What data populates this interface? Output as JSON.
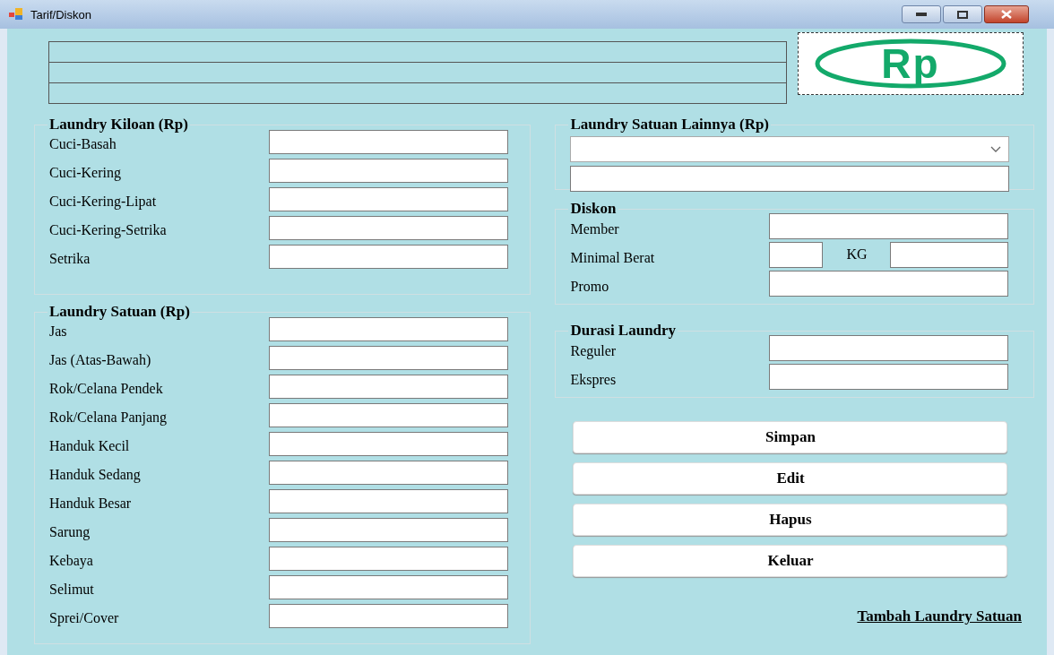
{
  "window": {
    "title": "Tarif/Diskon"
  },
  "header": {
    "logo_text": "Rp"
  },
  "laundry_kiloan": {
    "title": "Laundry Kiloan (Rp)",
    "fields": [
      {
        "label": "Cuci-Basah"
      },
      {
        "label": "Cuci-Kering"
      },
      {
        "label": "Cuci-Kering-Lipat"
      },
      {
        "label": "Cuci-Kering-Setrika"
      },
      {
        "label": "Setrika"
      }
    ]
  },
  "laundry_satuan": {
    "title": "Laundry Satuan (Rp)",
    "fields": [
      {
        "label": "Jas"
      },
      {
        "label": "Jas (Atas-Bawah)"
      },
      {
        "label": "Rok/Celana Pendek"
      },
      {
        "label": "Rok/Celana Panjang"
      },
      {
        "label": "Handuk Kecil"
      },
      {
        "label": "Handuk Sedang"
      },
      {
        "label": "Handuk Besar"
      },
      {
        "label": "Sarung"
      },
      {
        "label": "Kebaya"
      },
      {
        "label": "Selimut"
      },
      {
        "label": "Sprei/Cover"
      }
    ]
  },
  "laundry_satuan_lainnya": {
    "title": "Laundry Satuan Lainnya (Rp)"
  },
  "diskon": {
    "title": "Diskon",
    "fields": [
      {
        "label": "Member",
        "kind": "single"
      },
      {
        "label": "Minimal Berat",
        "kind": "split",
        "unit": "KG"
      },
      {
        "label": "Promo",
        "kind": "single"
      }
    ]
  },
  "durasi": {
    "title": "Durasi Laundry",
    "fields": [
      {
        "label": "Reguler"
      },
      {
        "label": "Ekspres"
      }
    ]
  },
  "buttons": [
    "Simpan",
    "Edit",
    "Hapus",
    "Keluar"
  ],
  "link": "Tambah Laundry Satuan"
}
